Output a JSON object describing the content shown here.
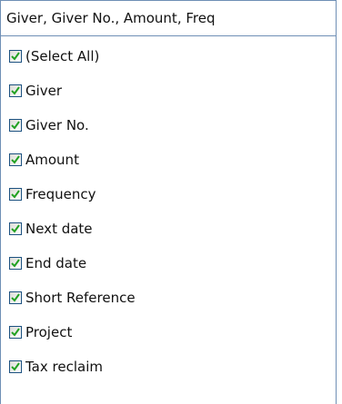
{
  "combo": {
    "value": "Giver, Giver No., Amount, Freq"
  },
  "options": [
    {
      "label": "(Select All)",
      "checked": true
    },
    {
      "label": "Giver",
      "checked": true
    },
    {
      "label": "Giver No.",
      "checked": true
    },
    {
      "label": "Amount",
      "checked": true
    },
    {
      "label": "Frequency",
      "checked": true
    },
    {
      "label": "Next date",
      "checked": true
    },
    {
      "label": "End date",
      "checked": true
    },
    {
      "label": "Short Reference",
      "checked": true
    },
    {
      "label": "Project",
      "checked": true
    },
    {
      "label": "Tax reclaim",
      "checked": true
    }
  ],
  "colors": {
    "check_mark": "#21a121",
    "border": "#6f8fb5"
  }
}
